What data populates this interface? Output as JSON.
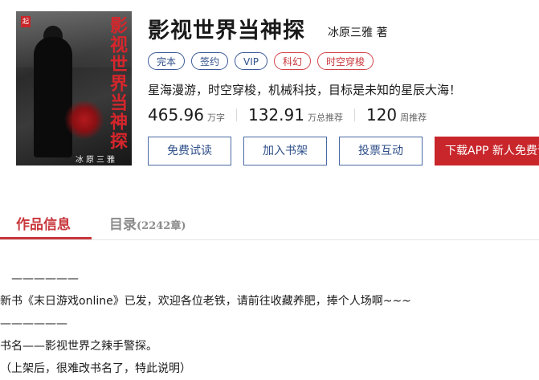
{
  "book": {
    "title": "影视世界当神探",
    "author": "冰原三雅",
    "author_suffix": "著",
    "cover_title_vertical": "影视世界当神探",
    "cover_author": "冰原三雅 著",
    "cover_badge": "起",
    "tags": [
      {
        "label": "完本",
        "style": "blue"
      },
      {
        "label": "签约",
        "style": "blue"
      },
      {
        "label": "VIP",
        "style": "blue"
      },
      {
        "label": "科幻",
        "style": "red"
      },
      {
        "label": "时空穿梭",
        "style": "red"
      }
    ],
    "intro": "星海漫游，时空穿梭，机械科技，目标是未知的星辰大海！",
    "stats": [
      {
        "value": "465.96",
        "unit": "万字"
      },
      {
        "value": "132.91",
        "unit": "万总推荐"
      },
      {
        "value": "120",
        "unit": "周推荐"
      }
    ]
  },
  "actions": {
    "free_read": "免费试读",
    "add_shelf": "加入书架",
    "vote": "投票互动",
    "app": "下载APP 新人免费读"
  },
  "tabs": {
    "info": "作品信息",
    "catalog": "目录",
    "catalog_count": "(2242章)"
  },
  "content": {
    "lines": [
      "　——————",
      "新书《末日游戏online》已发，欢迎各位老铁，请前往收藏养肥，捧个人场啊~~~",
      "——————",
      "书名——影视世界之辣手警探。",
      "（上架后，很难改书名了，特此说明）"
    ]
  },
  "colors": {
    "accent_red": "#c8262b",
    "link_blue": "#2e4f8a"
  }
}
